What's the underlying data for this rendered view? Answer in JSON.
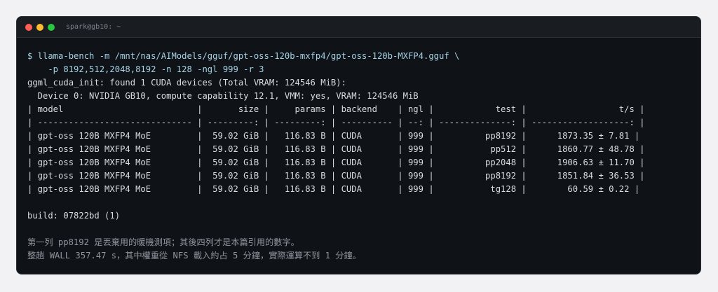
{
  "window": {
    "title": "spark@gb10: ~",
    "colors": {
      "close": "#ff5f57",
      "minimize": "#febc2e",
      "maximize": "#28c840"
    }
  },
  "command": [
    "$ llama-bench -m /mnt/nas/AIModels/gguf/gpt-oss-120b-mxfp4/gpt-oss-120b-MXFP4.gguf \\",
    "    -p 8192,512,2048,8192 -n 128 -ngl 999 -r 3"
  ],
  "init": [
    "ggml_cuda_init: found 1 CUDA devices (Total VRAM: 124546 MiB):",
    "  Device 0: NVIDIA GB10, compute capability 12.1, VMM: yes, VRAM: 124546 MiB"
  ],
  "table": {
    "header": "| model                          |       size |     params | backend    | ngl |            test |                  t/s |",
    "separator": "| ------------------------------ | ---------: | ---------: | ---------- | --: | --------------: | -------------------: |",
    "rows": [
      "| gpt-oss 120B MXFP4 MoE         |  59.02 GiB |   116.83 B | CUDA       | 999 |          pp8192 |      1873.35 ± 7.81 |",
      "| gpt-oss 120B MXFP4 MoE         |  59.02 GiB |   116.83 B | CUDA       | 999 |           pp512 |      1860.77 ± 48.78 |",
      "| gpt-oss 120B MXFP4 MoE         |  59.02 GiB |   116.83 B | CUDA       | 999 |          pp2048 |      1906.63 ± 11.70 |",
      "| gpt-oss 120B MXFP4 MoE         |  59.02 GiB |   116.83 B | CUDA       | 999 |          pp8192 |      1851.84 ± 36.53 |",
      "| gpt-oss 120B MXFP4 MoE         |  59.02 GiB |   116.83 B | CUDA       | 999 |           tg128 |        60.59 ± 0.22 |"
    ]
  },
  "build": "build: 07822bd (1)",
  "notes": [
    "第一列 pp8192 是丟棄用的暖機測項；其後四列才是本篇引用的數字。",
    "整趟 WALL 357.47 s，其中權重從 NFS 載入約占 5 分鐘，實際運算不到 1 分鐘。"
  ]
}
